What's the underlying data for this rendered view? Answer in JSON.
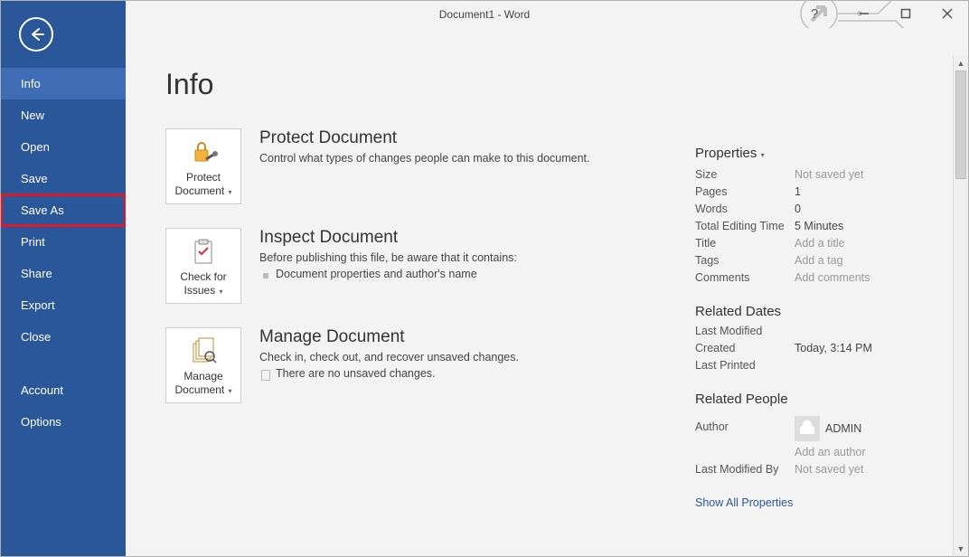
{
  "window": {
    "title": "Document1 - Word"
  },
  "sidebar": {
    "items": [
      {
        "label": "Info",
        "selected": true,
        "highlighted": false
      },
      {
        "label": "New",
        "selected": false,
        "highlighted": false
      },
      {
        "label": "Open",
        "selected": false,
        "highlighted": false
      },
      {
        "label": "Save",
        "selected": false,
        "highlighted": false
      },
      {
        "label": "Save As",
        "selected": false,
        "highlighted": true
      },
      {
        "label": "Print",
        "selected": false,
        "highlighted": false
      },
      {
        "label": "Share",
        "selected": false,
        "highlighted": false
      },
      {
        "label": "Export",
        "selected": false,
        "highlighted": false
      },
      {
        "label": "Close",
        "selected": false,
        "highlighted": false
      }
    ],
    "footer": [
      {
        "label": "Account"
      },
      {
        "label": "Options"
      }
    ]
  },
  "page": {
    "title": "Info"
  },
  "sections": {
    "protect": {
      "button_label": "Protect Document",
      "heading": "Protect Document",
      "text": "Control what types of changes people can make to this document."
    },
    "inspect": {
      "button_label": "Check for Issues",
      "heading": "Inspect Document",
      "text": "Before publishing this file, be aware that it contains:",
      "bullet": "Document properties and author's name"
    },
    "manage": {
      "button_label": "Manage Document",
      "heading": "Manage Document",
      "text": "Check in, check out, and recover unsaved changes.",
      "bullet": "There are no unsaved changes."
    }
  },
  "properties": {
    "heading": "Properties",
    "rows": {
      "size": {
        "k": "Size",
        "v": "Not saved yet",
        "grey": true
      },
      "pages": {
        "k": "Pages",
        "v": "1",
        "grey": false
      },
      "words": {
        "k": "Words",
        "v": "0",
        "grey": false
      },
      "tet": {
        "k": "Total Editing Time",
        "v": "5 Minutes",
        "grey": false
      },
      "title": {
        "k": "Title",
        "v": "Add a title",
        "grey": true
      },
      "tags": {
        "k": "Tags",
        "v": "Add a tag",
        "grey": true
      },
      "comm": {
        "k": "Comments",
        "v": "Add comments",
        "grey": true
      }
    },
    "related_dates": {
      "heading": "Related Dates",
      "last_modified": {
        "k": "Last Modified",
        "v": ""
      },
      "created": {
        "k": "Created",
        "v": "Today, 3:14 PM"
      },
      "last_printed": {
        "k": "Last Printed",
        "v": ""
      }
    },
    "related_people": {
      "heading": "Related People",
      "author_k": "Author",
      "author_v": "ADMIN",
      "add_author": "Add an author",
      "last_mod_by_k": "Last Modified By",
      "last_mod_by_v": "Not saved yet"
    },
    "show_all": "Show All Properties"
  }
}
